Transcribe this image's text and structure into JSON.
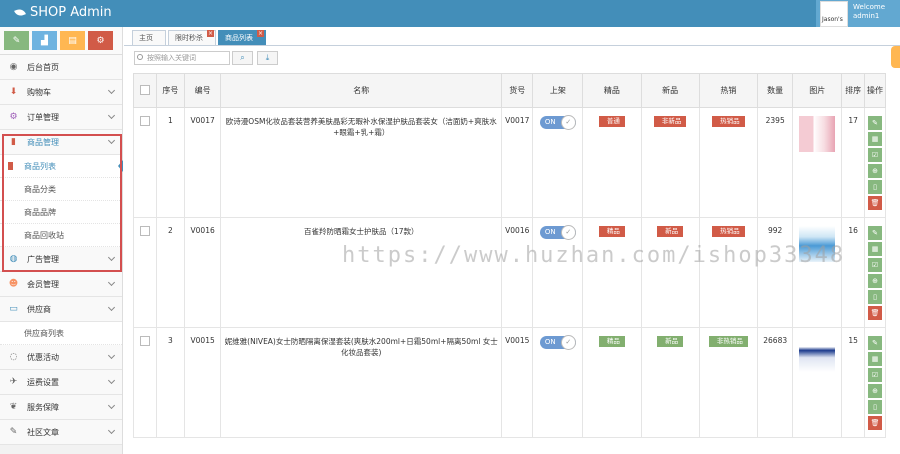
{
  "app": {
    "title": "SHOP Admin",
    "avatar_alt": "Jason's",
    "welcome": "Welcome",
    "username": "admin1"
  },
  "shortcuts": [
    {
      "icon": "pencil-icon",
      "color": "#87b87f",
      "glyph": "✎"
    },
    {
      "icon": "chart-icon",
      "color": "#6fb3e0",
      "glyph": "▟"
    },
    {
      "icon": "book-icon",
      "color": "#ffb752",
      "glyph": "▤"
    },
    {
      "icon": "cogs-icon",
      "color": "#d15b47",
      "glyph": "⚙"
    }
  ],
  "menu": [
    {
      "label": "后台首页",
      "icon": "dashboard-icon",
      "glyph": "◉",
      "chev": false
    },
    {
      "label": "购物车",
      "icon": "download-icon",
      "glyph": "⬇",
      "chev": true,
      "iconcolor": "#d15b47"
    },
    {
      "label": "订单管理",
      "icon": "cogs-icon",
      "glyph": "⚙",
      "chev": true,
      "iconcolor": "#9b59b6"
    },
    {
      "label": "商品管理",
      "icon": "bookmark-icon",
      "glyph": "▮",
      "chev": true,
      "iconcolor": "#d15b47",
      "open": true,
      "subs": [
        {
          "label": "商品列表",
          "active": true
        },
        {
          "label": "商品分类"
        },
        {
          "label": "商品品牌"
        },
        {
          "label": "商品回收站"
        }
      ]
    },
    {
      "label": "广告管理",
      "icon": "globe-icon",
      "glyph": "◍",
      "chev": true,
      "iconcolor": "#438eb9"
    },
    {
      "label": "会员管理",
      "icon": "users-icon",
      "glyph": "☻",
      "chev": true,
      "iconcolor": "#f79263"
    },
    {
      "label": "供应商",
      "icon": "laptop-icon",
      "glyph": "▭",
      "chev": true,
      "iconcolor": "#438eb9",
      "open": true,
      "subs": [
        {
          "label": "供应商列表"
        }
      ]
    },
    {
      "label": "优惠活动",
      "icon": "comment-icon",
      "glyph": "◌",
      "chev": true
    },
    {
      "label": "运费设置",
      "icon": "plane-icon",
      "glyph": "✈",
      "chev": true
    },
    {
      "label": "服务保障",
      "icon": "leaf-icon",
      "glyph": "❦",
      "chev": true
    },
    {
      "label": "社区文章",
      "icon": "edit-icon",
      "glyph": "✎",
      "chev": true
    }
  ],
  "tabs": [
    {
      "label": "主页",
      "closable": false,
      "active": false
    },
    {
      "label": "限时秒杀",
      "closable": true,
      "active": false
    },
    {
      "label": "商品列表",
      "closable": true,
      "active": true
    }
  ],
  "search": {
    "placeholder": "按照输入关键词"
  },
  "table": {
    "headers": [
      "",
      "序号",
      "编号",
      "名称",
      "货号",
      "上架",
      "精品",
      "新品",
      "热销",
      "数量",
      "图片",
      "排序",
      "操作"
    ],
    "rows": [
      {
        "seq": "1",
        "code": "V0017",
        "name": "欧诗漫OSM化妆品套装营养美肤晶彩无暇补水保湿护肤品套装女（洁面奶+爽肤水+眼霜+乳+霜）",
        "sku": "V0017",
        "onsale": "ON",
        "best": {
          "text": "普通",
          "color": "red"
        },
        "new": {
          "text": "非新品",
          "color": "red"
        },
        "hot": {
          "text": "热销品",
          "color": "red"
        },
        "qty": "2395",
        "sort": "17",
        "img": "img-pink"
      },
      {
        "seq": "2",
        "code": "V0016",
        "name": "百雀羚防晒霜女士护肤品（17款）",
        "sku": "V0016",
        "onsale": "ON",
        "best": {
          "text": "精品",
          "color": "red"
        },
        "new": {
          "text": "新品",
          "color": "red"
        },
        "hot": {
          "text": "热销品",
          "color": "red"
        },
        "qty": "992",
        "sort": "16",
        "img": "img-blue"
      },
      {
        "seq": "3",
        "code": "V0015",
        "name": "妮维雅(NIVEA)女士防晒隔离保湿套装(爽肤水200ml+日霜50ml+隔离50ml 女士化妆品套装)",
        "sku": "V0015",
        "onsale": "ON",
        "best": {
          "text": "精品",
          "color": "green"
        },
        "new": {
          "text": "新品",
          "color": "green"
        },
        "hot": {
          "text": "非热销品",
          "color": "green"
        },
        "qty": "26683",
        "sort": "15",
        "img": "img-nivea"
      }
    ]
  },
  "watermark": "https://www.huzhan.com/ishop33348"
}
